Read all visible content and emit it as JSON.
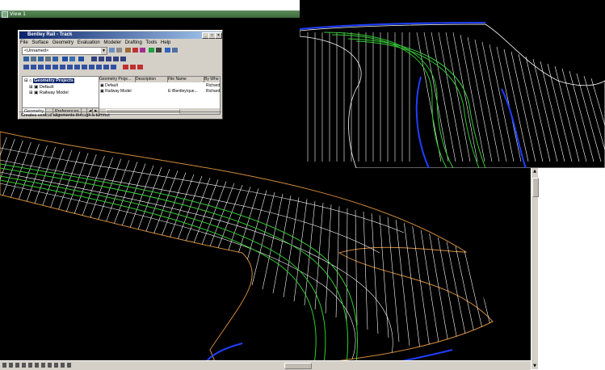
{
  "viewport": {
    "title": "View 1"
  },
  "app": {
    "title": "Bentley Rail - Track",
    "menu": [
      "File",
      "Surface",
      "Geometry",
      "Evaluation",
      "Modeler",
      "Drafting",
      "Tools",
      "Help"
    ],
    "combo_value": "<Unnamed>",
    "tree": {
      "root": "Geometry Projects",
      "items": [
        "Default",
        "Railway Model"
      ]
    },
    "tabs": [
      "Geometry",
      "Preferences"
    ],
    "list": {
      "headers": [
        "Geometry Proje...",
        "Description",
        "File Name",
        "By Who"
      ],
      "rows": [
        {
          "name": "Default",
          "description": "",
          "file": "",
          "by": "Richard"
        },
        {
          "name": "Railway Model",
          "description": "",
          "file": "E:\\Bentley\\que...",
          "by": "Richard"
        }
      ]
    },
    "status": "Creates vertical alignments through a turnout"
  },
  "colors": {
    "viewport_bg": "#000000",
    "mesh_white": "#ffffff",
    "track_green": "#33cc33",
    "edge_blue": "#1f3fff",
    "boundary_orange": "#d08a3c",
    "title_blue": "#0a246a"
  }
}
